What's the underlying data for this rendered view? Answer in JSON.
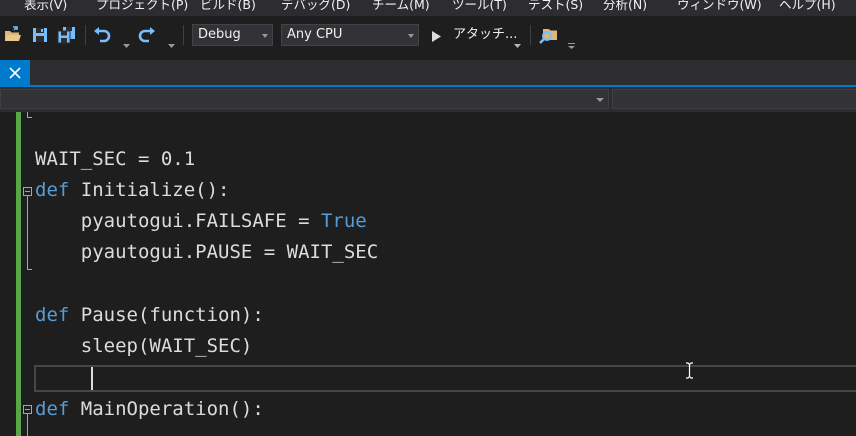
{
  "menu": {
    "items": [
      "表示(V)",
      "プロジェクト(P)",
      "ビルド(B)",
      "デバッグ(D)",
      "チーム(M)",
      "ツール(T)",
      "テスト(S)",
      "分析(N)",
      "ウィンドウ(W)",
      "ヘルプ(H)"
    ]
  },
  "toolbar": {
    "configuration": "Debug",
    "platform": "Any CPU",
    "start_label": "アタッチ...",
    "icons": [
      "open-folder-icon",
      "save-icon",
      "save-all-icon",
      "undo-icon",
      "redo-icon",
      "start-icon",
      "find-in-files-icon",
      "toolbar-overflow-icon"
    ]
  },
  "colors": {
    "accent": "#007acc",
    "keyword": "#569cd6",
    "change_margin": "#57a64a",
    "editor_bg": "#1e1e1e",
    "chrome_bg": "#2d2d30"
  },
  "editor": {
    "lines": [
      {
        "tokens": [
          {
            "t": "WAIT_SEC = 0.1",
            "c": "plain"
          }
        ]
      },
      {
        "tokens": [
          {
            "t": "def",
            "c": "kw"
          },
          {
            "t": " Initialize():",
            "c": "plain"
          }
        ]
      },
      {
        "tokens": [
          {
            "t": "    pyautogui.FAILSAFE = ",
            "c": "plain"
          },
          {
            "t": "True",
            "c": "kw"
          }
        ]
      },
      {
        "tokens": [
          {
            "t": "    pyautogui.PAUSE = WAIT_SEC",
            "c": "plain"
          }
        ]
      },
      {
        "tokens": [
          {
            "t": "",
            "c": "plain"
          }
        ]
      },
      {
        "tokens": [
          {
            "t": "def",
            "c": "kw"
          },
          {
            "t": " Pause(function):",
            "c": "plain"
          }
        ]
      },
      {
        "tokens": [
          {
            "t": "    sleep(WAIT_SEC)",
            "c": "plain"
          }
        ]
      },
      {
        "tokens": [
          {
            "t": "",
            "c": "plain"
          }
        ]
      },
      {
        "tokens": [
          {
            "t": "def",
            "c": "kw"
          },
          {
            "t": " MainOperation():",
            "c": "plain"
          }
        ]
      }
    ]
  }
}
